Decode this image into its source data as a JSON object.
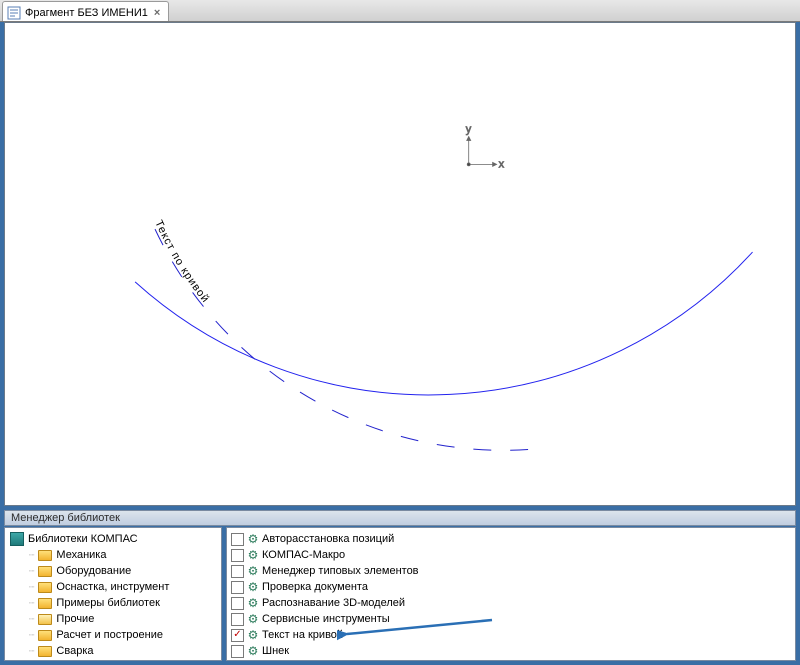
{
  "tab": {
    "title": "Фрагмент БЕЗ ИМЕНИ1"
  },
  "axis": {
    "x": "x",
    "y": "y"
  },
  "canvas_text": "Текст по кривой",
  "lm": {
    "title": "Менеджер библиотек",
    "root": "Библиотеки КОМПАС",
    "tree": [
      "Механика",
      "Оборудование",
      "Оснастка, инструмент",
      "Примеры библиотек",
      "Прочие",
      "Расчет и построение",
      "Сварка"
    ],
    "list": [
      {
        "label": "Авторасстановка позиций",
        "checked": false
      },
      {
        "label": "КОМПАС-Макро",
        "checked": false
      },
      {
        "label": "Менеджер типовых элементов",
        "checked": false
      },
      {
        "label": "Проверка документа",
        "checked": false
      },
      {
        "label": "Распознавание 3D-моделей",
        "checked": false
      },
      {
        "label": "Сервисные инструменты",
        "checked": false
      },
      {
        "label": "Текст на кривой",
        "checked": true
      },
      {
        "label": "Шнек",
        "checked": false
      }
    ]
  }
}
